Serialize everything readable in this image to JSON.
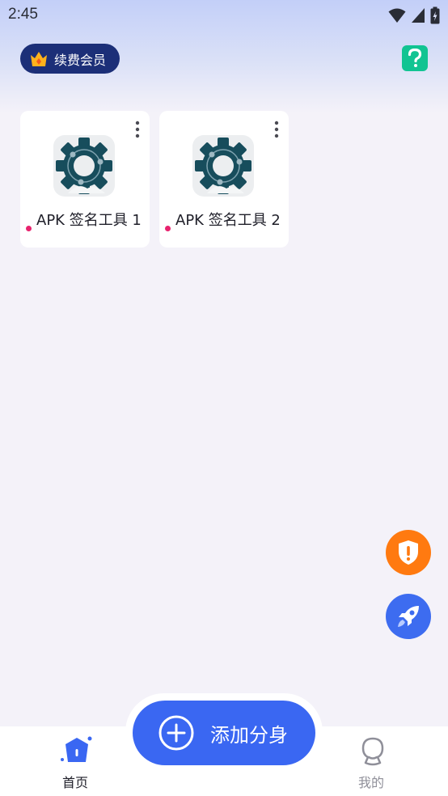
{
  "status_bar": {
    "time": "2:45",
    "icons": [
      "wifi-icon",
      "signal-icon",
      "battery-charging-icon"
    ]
  },
  "header": {
    "vip_label": "续费会员",
    "help_label": "?"
  },
  "apps": [
    {
      "name": "APK 签名工具 1",
      "icon": "gear-icon"
    },
    {
      "name": "APK 签名工具 2",
      "icon": "gear-icon"
    }
  ],
  "floating_buttons": [
    "shield-alert-icon",
    "rocket-icon"
  ],
  "add_button": {
    "label": "添加分身"
  },
  "bottom_nav": {
    "items": [
      {
        "label": "首页",
        "icon": "home-icon",
        "active": true
      },
      {
        "label": "我的",
        "icon": "profile-icon",
        "active": false
      }
    ]
  },
  "colors": {
    "accent": "#3a67f2",
    "vip_bg": "#1c2f78",
    "help": "#12c492",
    "shield": "#ff7a10",
    "status_dot": "#e8236e",
    "gear": "#174d5c"
  }
}
